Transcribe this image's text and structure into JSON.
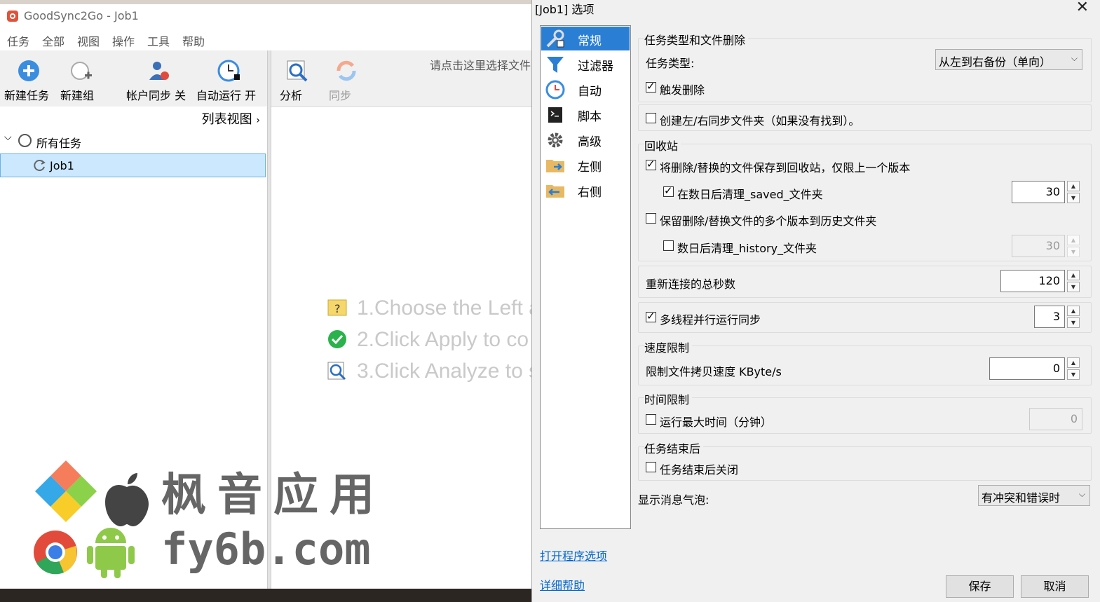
{
  "app": {
    "title": "GoodSync2Go - Job1",
    "menu": [
      "任务",
      "全部",
      "视图",
      "操作",
      "工具",
      "帮助"
    ],
    "toolbar_left": {
      "new_task": "新建任务",
      "new_group": "新建组",
      "account_sync": "帐户同步 关",
      "auto_run": "自动运行 开"
    },
    "toolbar_right": {
      "analyze": "分析",
      "sync": "同步",
      "select_folder_hint": "请点击这里选择文件"
    },
    "list_view": "列表视图",
    "tree": {
      "all_tasks": "所有任务",
      "job": "Job1"
    },
    "hints": [
      "1.Choose the Left a",
      "2.Click Apply to co",
      "3.Click Analyze to s"
    ],
    "watermark": {
      "line1": "枫音应用",
      "line2": "fy6b.com"
    }
  },
  "dialog": {
    "title": "[Job1] 选项",
    "close": "✕",
    "categories": [
      "常规",
      "过滤器",
      "自动",
      "脚本",
      "高级",
      "左侧",
      "右侧"
    ],
    "task_type_group": "任务类型和文件删除",
    "task_type_label": "任务类型:",
    "task_type_value": "从左到右备份（单向）",
    "trigger_delete": "触发删除",
    "create_folders": "创建左/右同步文件夹（如果没有找到）。",
    "recycle_group": "回收站",
    "save_to_recycle": "将删除/替换的文件保存到回收站，仅限上一个版本",
    "clean_saved": "在数日后清理_saved_文件夹",
    "clean_saved_days": "30",
    "keep_history": "保留删除/替换文件的多个版本到历史文件夹",
    "clean_history": "数日后清理_history_文件夹",
    "clean_history_days": "30",
    "reconnect_label": "重新连接的总秒数",
    "reconnect_value": "120",
    "multithread_label": "多线程并行运行同步",
    "multithread_value": "3",
    "speed_group": "速度限制",
    "speed_label": "限制文件拷贝速度 KByte/s",
    "speed_value": "0",
    "time_group": "时间限制",
    "max_time_label": "运行最大时间（分钟）",
    "max_time_value": "0",
    "after_group": "任务结束后",
    "close_after": "任务结束后关闭",
    "bubble_label": "显示消息气泡:",
    "bubble_value": "有冲突和错误时",
    "open_program_options": "打开程序选项",
    "detailed_help": "详细帮助",
    "save": "保存",
    "cancel": "取消"
  }
}
